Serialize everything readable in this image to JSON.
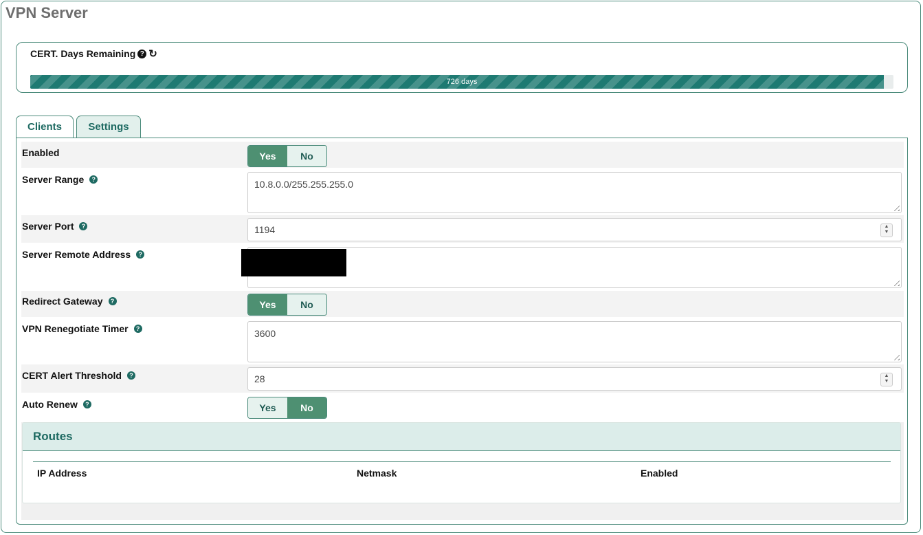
{
  "page": {
    "title": "VPN Server"
  },
  "cert": {
    "label": "CERT. Days Remaining",
    "progress_text": "726 days",
    "progress_fraction": 0.989,
    "accent": "#1e7a72"
  },
  "tabs": [
    {
      "label": "Clients",
      "active": false
    },
    {
      "label": "Settings",
      "active": true
    }
  ],
  "settings": {
    "enabled": {
      "label": "Enabled",
      "yes": "Yes",
      "no": "No",
      "value": "Yes"
    },
    "server_range": {
      "label": "Server Range",
      "value": "10.8.0.0/255.255.255.0"
    },
    "server_port": {
      "label": "Server Port",
      "value": "1194"
    },
    "server_remote_address": {
      "label": "Server Remote Address",
      "value": ""
    },
    "redirect_gateway": {
      "label": "Redirect Gateway",
      "yes": "Yes",
      "no": "No",
      "value": "Yes"
    },
    "renegotiate_timer": {
      "label": "VPN Renegotiate Timer",
      "value": "3600"
    },
    "cert_alert_threshold": {
      "label": "CERT Alert Threshold",
      "value": "28"
    },
    "auto_renew": {
      "label": "Auto Renew",
      "yes": "Yes",
      "no": "No",
      "value": "No"
    }
  },
  "routes": {
    "title": "Routes",
    "columns": [
      "IP Address",
      "Netmask",
      "Enabled"
    ]
  },
  "icons": {
    "help": "question-circle-icon",
    "refresh": "refresh-icon"
  },
  "colors": {
    "toggle_on": "#4e9072",
    "toggle_off": "#e6f2ee",
    "border": "#4a8a7a"
  }
}
